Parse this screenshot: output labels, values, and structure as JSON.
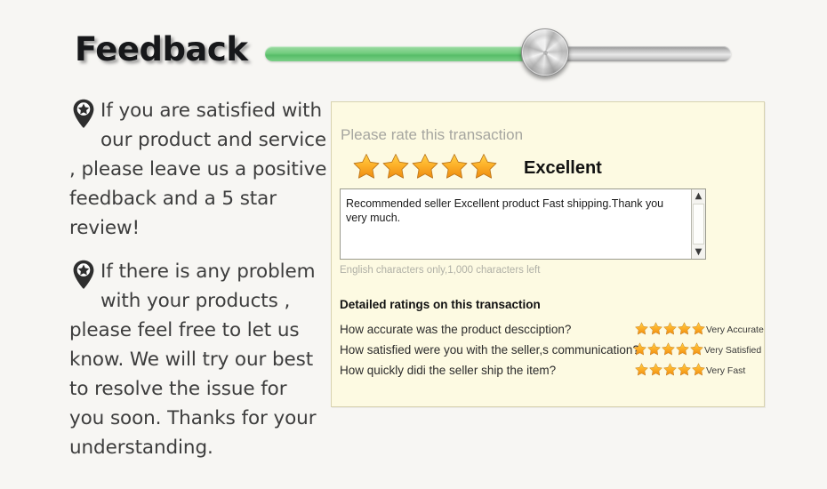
{
  "page": {
    "title": "Feedback",
    "background_color": "#f7f6f3"
  },
  "slider": {
    "name": "progress-slider",
    "fill_color": "#6bca79",
    "track_color": "#c9c9c9",
    "value_percent": 57
  },
  "notes": [
    {
      "icon": "map-pin-star-icon",
      "text": "If you are satisfied with our product and service , please leave us a positive feedback and a 5 star review!"
    },
    {
      "icon": "map-pin-star-icon",
      "text": "If there is any problem with your products , please feel free to let us know. We will try our best to resolve the issue for you soon. Thanks for your understanding."
    }
  ],
  "rating_panel": {
    "background_color": "#fdfae2",
    "border_color": "#d8d3b0",
    "prompt": "Please rate this transaction",
    "star_count": 5,
    "star_color": "#f4a014",
    "rating_word": "Excellent",
    "comment": {
      "value": "Recommended seller Excellent product Fast shipping.Thank you very much.",
      "placeholder": "",
      "scroll_up_icon": "chevron-up-icon",
      "scroll_down_icon": "chevron-down-icon"
    },
    "char_note": "English characters only,1,000 characters left",
    "detailed_title": "Detailed ratings on this transaction",
    "detailed_rows": [
      {
        "question": "How accurate was the product descciption?",
        "stars": 5,
        "label": "Very Accurate"
      },
      {
        "question": "How satisfied were you with the seller,s communication?",
        "stars": 5,
        "label": "Very Satisfied"
      },
      {
        "question": "How quickly didi the seller ship the item?",
        "stars": 5,
        "label": "Very Fast"
      }
    ]
  }
}
